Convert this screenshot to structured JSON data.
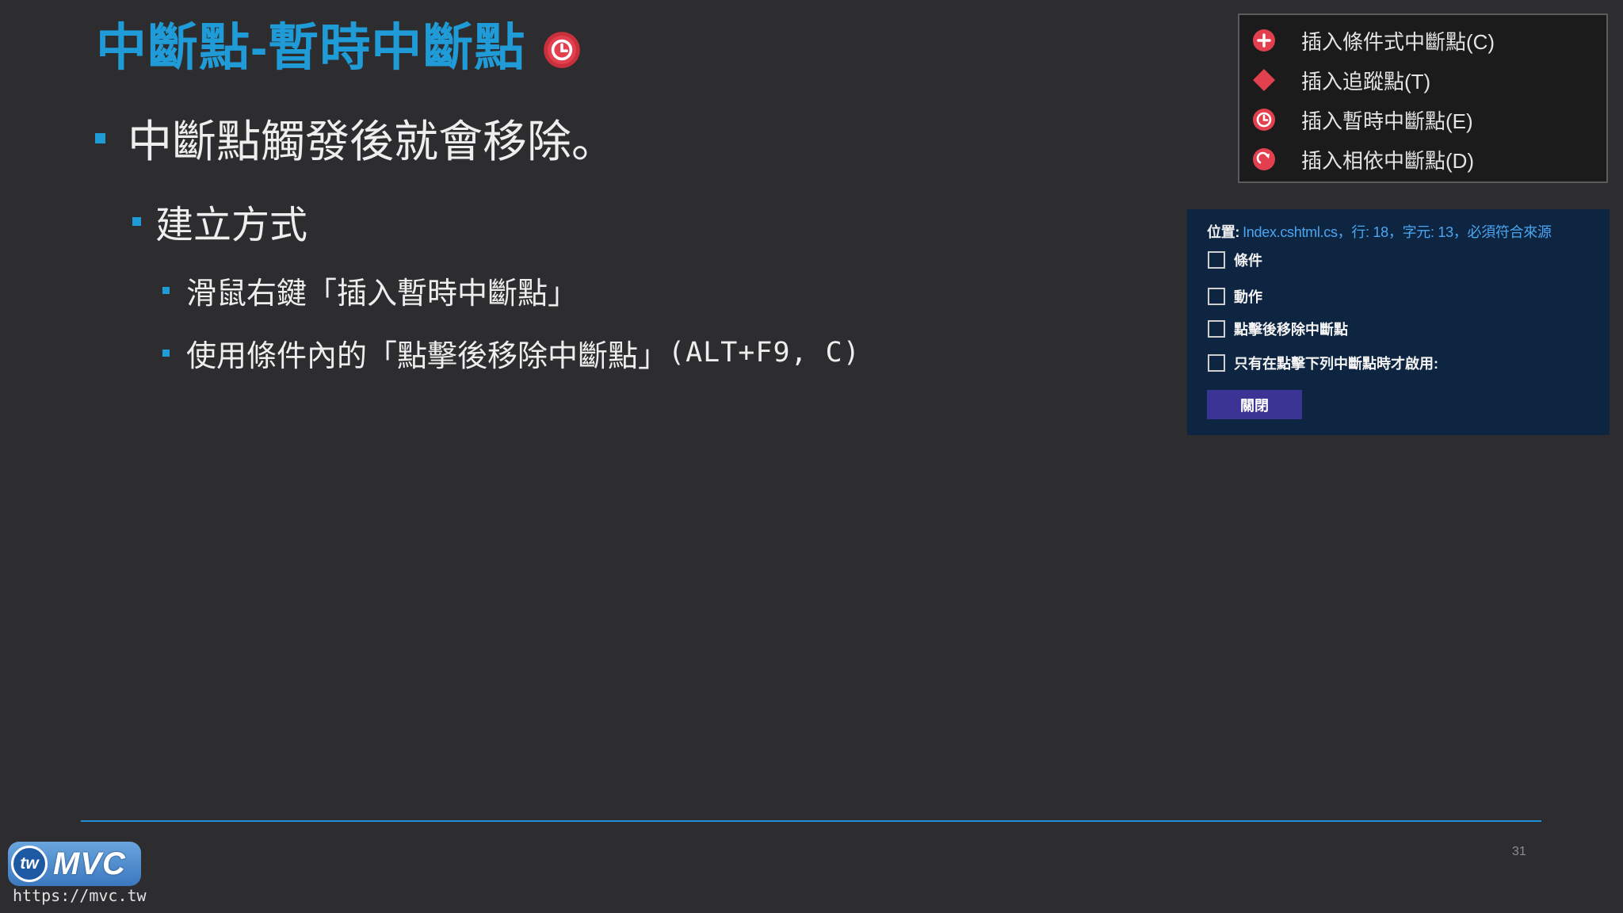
{
  "slide": {
    "title": "中斷點-暫時中斷點",
    "title_icon": "temporary-breakpoint-icon",
    "page_number": "31",
    "colors": {
      "background": "#2d2d30",
      "title": "#1f9bd7",
      "accent": "#1f8fd6",
      "breakpoint_red": "#e2404f",
      "panel_background": "#0e2542",
      "link_blue": "#4aa6f2",
      "button": "#3c3494"
    }
  },
  "bullets": [
    {
      "level": 1,
      "text": "中斷點觸發後就會移除。"
    },
    {
      "level": 2,
      "text": "建立方式"
    },
    {
      "level": 3,
      "text": "滑鼠右鍵「插入暫時中斷點」"
    },
    {
      "level": 3,
      "text": "使用條件內的「點擊後移除中斷點」",
      "shortcut": "(ALT+F9, C)"
    }
  ],
  "context_menu": {
    "items": [
      {
        "label": "插入條件式中斷點(C)",
        "icon": "conditional-breakpoint-icon"
      },
      {
        "label": "插入追蹤點(T)",
        "icon": "tracepoint-icon"
      },
      {
        "label": "插入暫時中斷點(E)",
        "icon": "temporary-breakpoint-icon"
      },
      {
        "label": "插入相依中斷點(D)",
        "icon": "dependent-breakpoint-icon"
      }
    ]
  },
  "breakpoint_settings": {
    "location_label": "位置:",
    "location_value": "Index.cshtml.cs，行: 18，字元: 13，必須符合來源",
    "options": [
      {
        "label": "條件",
        "checked": false
      },
      {
        "label": "動作",
        "checked": false
      },
      {
        "label": "點擊後移除中斷點",
        "checked": false
      },
      {
        "label": "只有在點擊下列中斷點時才啟用:",
        "checked": false
      }
    ],
    "close_button": "關閉"
  },
  "footer": {
    "logo_badge": "tw",
    "logo_text": "MVC",
    "url": "https://mvc.tw"
  }
}
